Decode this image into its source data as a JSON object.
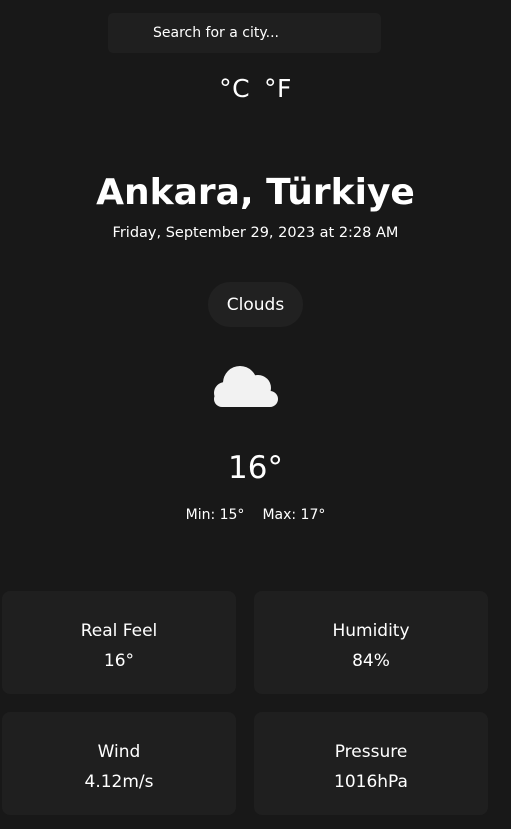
{
  "search": {
    "placeholder": "Search for a city..."
  },
  "units": {
    "celsius": "°C",
    "fahrenheit": "°F"
  },
  "location": "Ankara, Türkiye",
  "datetime": "Friday, September 29, 2023 at 2:28 AM",
  "condition": "Clouds",
  "icon": "cloud-icon",
  "temperature": "16°",
  "min": "Min: 15°",
  "max": "Max: 17°",
  "details": [
    {
      "label": "Real Feel",
      "value": "16°"
    },
    {
      "label": "Humidity",
      "value": "84%"
    },
    {
      "label": "Wind",
      "value": "4.12m/s"
    },
    {
      "label": "Pressure",
      "value": "1016hPa"
    }
  ],
  "colors": {
    "background": "#181818",
    "surface": "#1f1f1f",
    "text": "#ffffff"
  }
}
